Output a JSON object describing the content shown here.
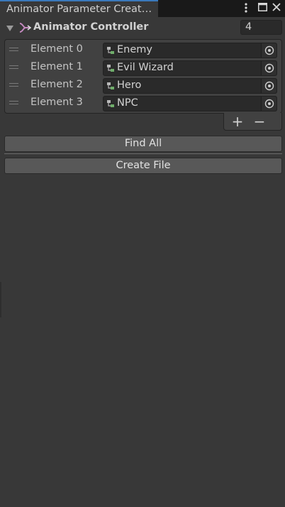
{
  "window": {
    "tab_title": "Animator Parameter Creat…",
    "menu_icon": "kebab-menu-icon",
    "maximize_icon": "maximize-icon",
    "close_icon": "close-icon"
  },
  "header": {
    "label": "Animator Controller",
    "icon": "animator-controller-icon",
    "array_size": "4"
  },
  "elements": [
    {
      "label": "Element 0",
      "value": "Enemy"
    },
    {
      "label": "Element 1",
      "value": "Evil Wizard"
    },
    {
      "label": "Element 2",
      "value": "Hero"
    },
    {
      "label": "Element 3",
      "value": "NPC"
    }
  ],
  "list_footer": {
    "add_label": "+",
    "remove_label": "−"
  },
  "buttons": {
    "find_all": "Find All",
    "create_file": "Create File"
  },
  "colors": {
    "background": "#383838",
    "tab_accent": "#3a79bb",
    "button": "#585858"
  }
}
